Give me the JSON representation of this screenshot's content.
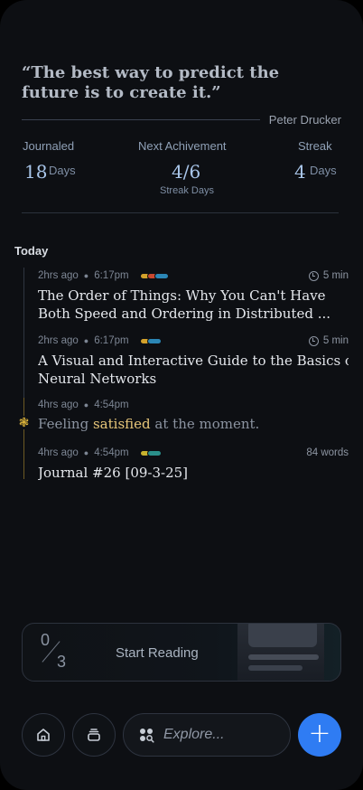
{
  "quote": {
    "text": "“The best way to predict the future is to create it.”",
    "author": "Peter Drucker"
  },
  "stats": {
    "journaled": {
      "label": "Journaled",
      "value": "18",
      "unit": "Days"
    },
    "next_achievement": {
      "label": "Next Achivement",
      "value": "4/6",
      "sub": "Streak Days"
    },
    "streak": {
      "label": "Streak",
      "value": "4",
      "unit": "Days"
    }
  },
  "timeline": {
    "section_label": "Today",
    "entries": [
      {
        "ago": "2hrs ago",
        "time": "6:17pm",
        "duration": "5 min",
        "title_line1": "The Order of Things: Why You Can't Have",
        "title_line2": "Both Speed and Ordering in Distributed ...",
        "tags": [
          "#d3a12b",
          "#c8482f",
          "#2b86b5"
        ]
      },
      {
        "ago": "2hrs ago",
        "time": "6:17pm",
        "duration": "5 min",
        "title_line1": "A Visual and Interactive Guide to the Basics of",
        "title_line2": "Neural Networks",
        "tags": [
          "#d3a12b",
          "#2b86b5"
        ]
      },
      {
        "ago": "4hrs ago",
        "time": "4:54pm",
        "feeling_pre": "Feeling",
        "feeling_word": "satisfied",
        "feeling_post": "at the moment."
      },
      {
        "ago": "4hrs ago",
        "time": "4:54pm",
        "words": "84 words",
        "title_line1": "Journal #26 [09-3-25]",
        "tags": [
          "#c7b22e",
          "#2a8f8a"
        ]
      }
    ]
  },
  "reading": {
    "done": "0",
    "total": "3",
    "label": "Start Reading"
  },
  "nav": {
    "explore_placeholder": "Explore...",
    "add_label": "+"
  },
  "colors": {
    "accent": "#2f7cf3",
    "feeling_highlight": "#e8c77a",
    "stat_value": "#a9c6ea"
  },
  "icons": {
    "home": "home-icon",
    "stack": "stack-icon",
    "explore": "explore-icon",
    "clock": "clock-icon",
    "feeling": "flower-icon"
  }
}
